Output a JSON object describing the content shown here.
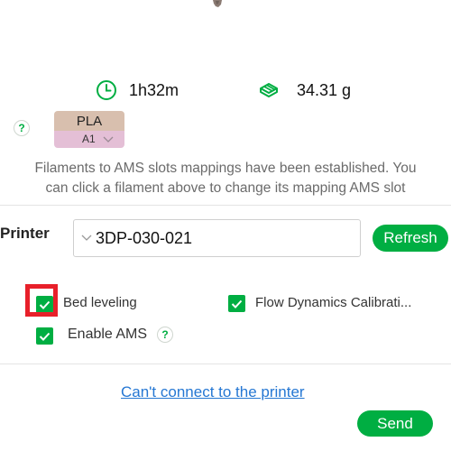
{
  "stats": {
    "time": "1h32m",
    "weight": "34.31 g"
  },
  "filament": {
    "type": "PLA",
    "slot": "A1",
    "color": "#d8bfae",
    "slot_color": "#e4bfd6"
  },
  "help": {
    "symbol": "?"
  },
  "mapping_message": {
    "line1": "Filaments to AMS slots mappings have been established. You",
    "line2": "can click a filament above to change its mapping AMS slot"
  },
  "printer": {
    "label": "Printer",
    "selected": "3DP-030-021",
    "refresh_label": "Refresh"
  },
  "options": {
    "bed_leveling": "Bed leveling",
    "flow_calibration": "Flow Dynamics Calibrati...",
    "enable_ams": "Enable AMS"
  },
  "footer": {
    "cant_connect": "Can't connect to the printer",
    "send_label": "Send"
  },
  "colors": {
    "accent": "#00ae42",
    "highlight": "#e8202a",
    "link": "#2577d3"
  }
}
